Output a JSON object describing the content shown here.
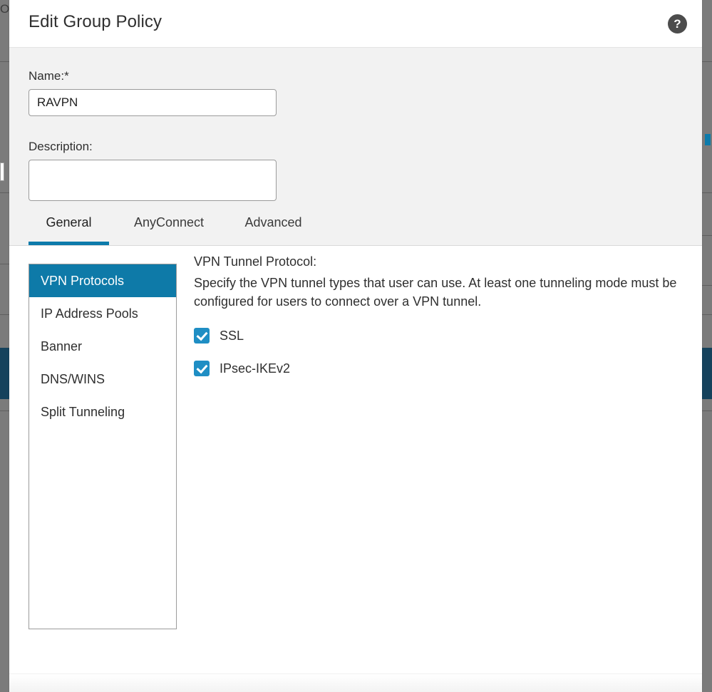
{
  "background": {
    "left_label_partial": "Ov",
    "rail_color": "#7b7b7b",
    "selected_color": "#15425c",
    "accent_color": "#0d7bab",
    "printer_icon": "printer-icon"
  },
  "dialog": {
    "title": "Edit Group Policy",
    "help_icon": "?",
    "help_icon_name": "help-icon",
    "fields": {
      "name_label": "Name:*",
      "name_value": "RAVPN",
      "name_placeholder": "",
      "description_label": "Description:",
      "description_value": "",
      "description_placeholder": ""
    },
    "tabs": [
      {
        "label": "General",
        "active": true
      },
      {
        "label": "AnyConnect",
        "active": false
      },
      {
        "label": "Advanced",
        "active": false
      }
    ],
    "side_list": [
      {
        "label": "VPN Protocols",
        "selected": true
      },
      {
        "label": "IP Address Pools",
        "selected": false
      },
      {
        "label": "Banner",
        "selected": false
      },
      {
        "label": "DNS/WINS",
        "selected": false
      },
      {
        "label": "Split Tunneling",
        "selected": false
      }
    ],
    "panel": {
      "title": "VPN Tunnel Protocol:",
      "description": "Specify the VPN tunnel types that user can use. At least one tunneling mode must be configured for users to connect over a VPN tunnel.",
      "checkboxes": [
        {
          "label": "SSL",
          "checked": true
        },
        {
          "label": "IPsec-IKEv2",
          "checked": true
        }
      ]
    }
  },
  "colors": {
    "tab_accent": "#0d7bab",
    "list_selected": "#0e7aa8",
    "checkbox": "#1f8ec4",
    "header_text": "#2f2f2f",
    "body_bg": "#f2f2f2"
  }
}
